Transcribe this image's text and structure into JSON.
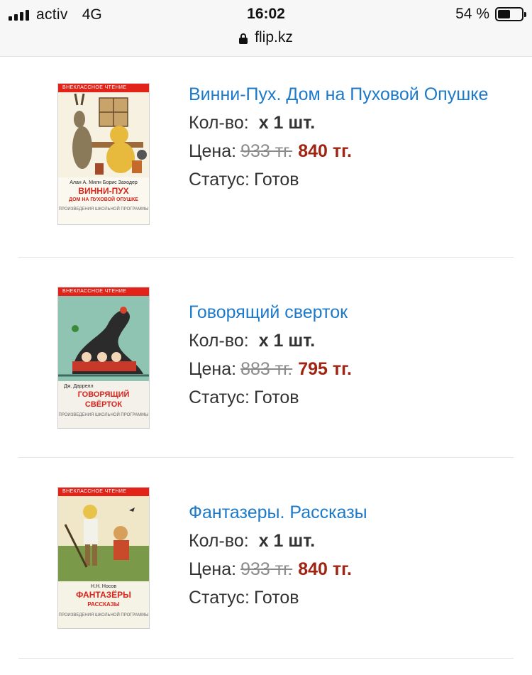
{
  "status_bar": {
    "carrier": "activ",
    "network": "4G",
    "time": "16:02",
    "battery": "54 %",
    "battery_level": 0.54,
    "url": "flip.kz"
  },
  "labels": {
    "qty": "Кол-во:",
    "price": "Цена:",
    "status": "Статус:"
  },
  "items": [
    {
      "title": "Винни-Пух. Дом на Пуховой Опушке",
      "qty": "х 1 шт.",
      "old_price": "933 тг.",
      "price": "840 тг.",
      "status": "Готов",
      "cover": {
        "series": "ВНЕКЛАССНОЕ ЧТЕНИЕ",
        "author": "Алан А. Милн  Борис Заходер",
        "title": "ВИННИ-ПУХ",
        "subtitle": "ДОМ НА ПУХОВОЙ ОПУШКЕ",
        "note": "ПРОИЗВЕДЕНИЯ ШКОЛЬНОЙ ПРОГРАММЫ"
      }
    },
    {
      "title": "Говорящий сверток",
      "qty": "х 1 шт.",
      "old_price": "883 тг.",
      "price": "795 тг.",
      "status": "Готов",
      "cover": {
        "series": "ВНЕКЛАССНОЕ ЧТЕНИЕ",
        "author": "Дж. Даррелл",
        "title": "ГОВОРЯЩИЙ",
        "subtitle": "СВЁРТОК",
        "note": "ПРОИЗВЕДЕНИЯ ШКОЛЬНОЙ ПРОГРАММЫ"
      }
    },
    {
      "title": "Фантазеры. Рассказы",
      "qty": "х 1 шт.",
      "old_price": "933 тг.",
      "price": "840 тг.",
      "status": "Готов",
      "cover": {
        "series": "ВНЕКЛАССНОЕ ЧТЕНИЕ",
        "author": "Н.Н. Носов",
        "title": "ФАНТАЗЁРЫ",
        "subtitle": "РАССКАЗЫ",
        "note": "ПРОИЗВЕДЕНИЯ ШКОЛЬНОЙ ПРОГРАММЫ"
      }
    }
  ],
  "colors": {
    "link": "#1d79c9",
    "price": "#a12413",
    "old_price": "#8b8b8b",
    "cover_band": "#e2231a"
  }
}
